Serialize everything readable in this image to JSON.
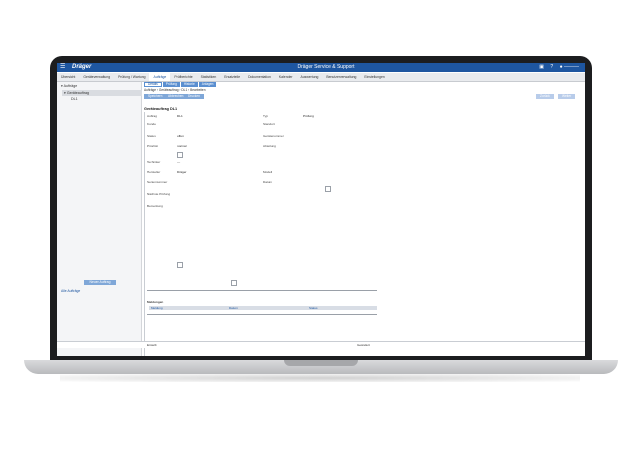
{
  "header": {
    "logo": "Dräger",
    "title": "Dräger Service & Support",
    "user": "● ———"
  },
  "nav": {
    "items": [
      "Übersicht",
      "Geräteverwaltung",
      "Prüfung / Wartung",
      "Aufträge",
      "Prüfberichte",
      "Statistiken",
      "Ersatzteile",
      "Dokumentation",
      "Kalender",
      "Auswertung",
      "Benutzerverwaltung",
      "Einstellungen"
    ],
    "active_index": 3
  },
  "sidebar": {
    "root": "Aufträge",
    "selected": "Geräteauftrag",
    "child": "DL1",
    "button": "Neuer Auftrag",
    "link": "Alle Aufträge"
  },
  "main": {
    "tabs": [
      "Details",
      "Prüfung",
      "Historie",
      "Anlagen"
    ],
    "breadcrumb": "Aufträge  ›  Geräteauftrag  ›  DL1  ›  Bearbeiten",
    "buttons": {
      "save": "Speichern",
      "cancel": "Abbrechen",
      "print": "Drucken"
    },
    "right_buttons": {
      "prev": "Zurück",
      "next": "Weiter"
    },
    "form_title": "Geräteauftrag DL1",
    "fields": {
      "auftrag_label": "Auftrag",
      "auftrag_value": "DL1",
      "typ_label": "Typ",
      "typ_value": "Prüfung",
      "kunde_label": "Kunde",
      "standort_label": "Standort",
      "status_label": "Status",
      "status_value": "offen",
      "geraetenr_label": "Gerätenummer",
      "prioritaet_label": "Priorität",
      "prioritaet_value": "normal",
      "abteilung_label": "Abteilung",
      "techniker_label": "Techniker",
      "techniker_value": "—",
      "hersteller_label": "Hersteller",
      "hersteller_value": "Dräger",
      "modell_label": "Modell",
      "seriennr_label": "Seriennummer",
      "datum_label": "Datum",
      "naechste_label": "Nächste Prüfung",
      "bemerkung_label": "Bemerkung"
    },
    "section_messages": "Meldungen",
    "table_headers": [
      "Meldung",
      "Datum",
      "Status"
    ],
    "footer_left": "Erstellt",
    "footer_right": "Geändert"
  }
}
